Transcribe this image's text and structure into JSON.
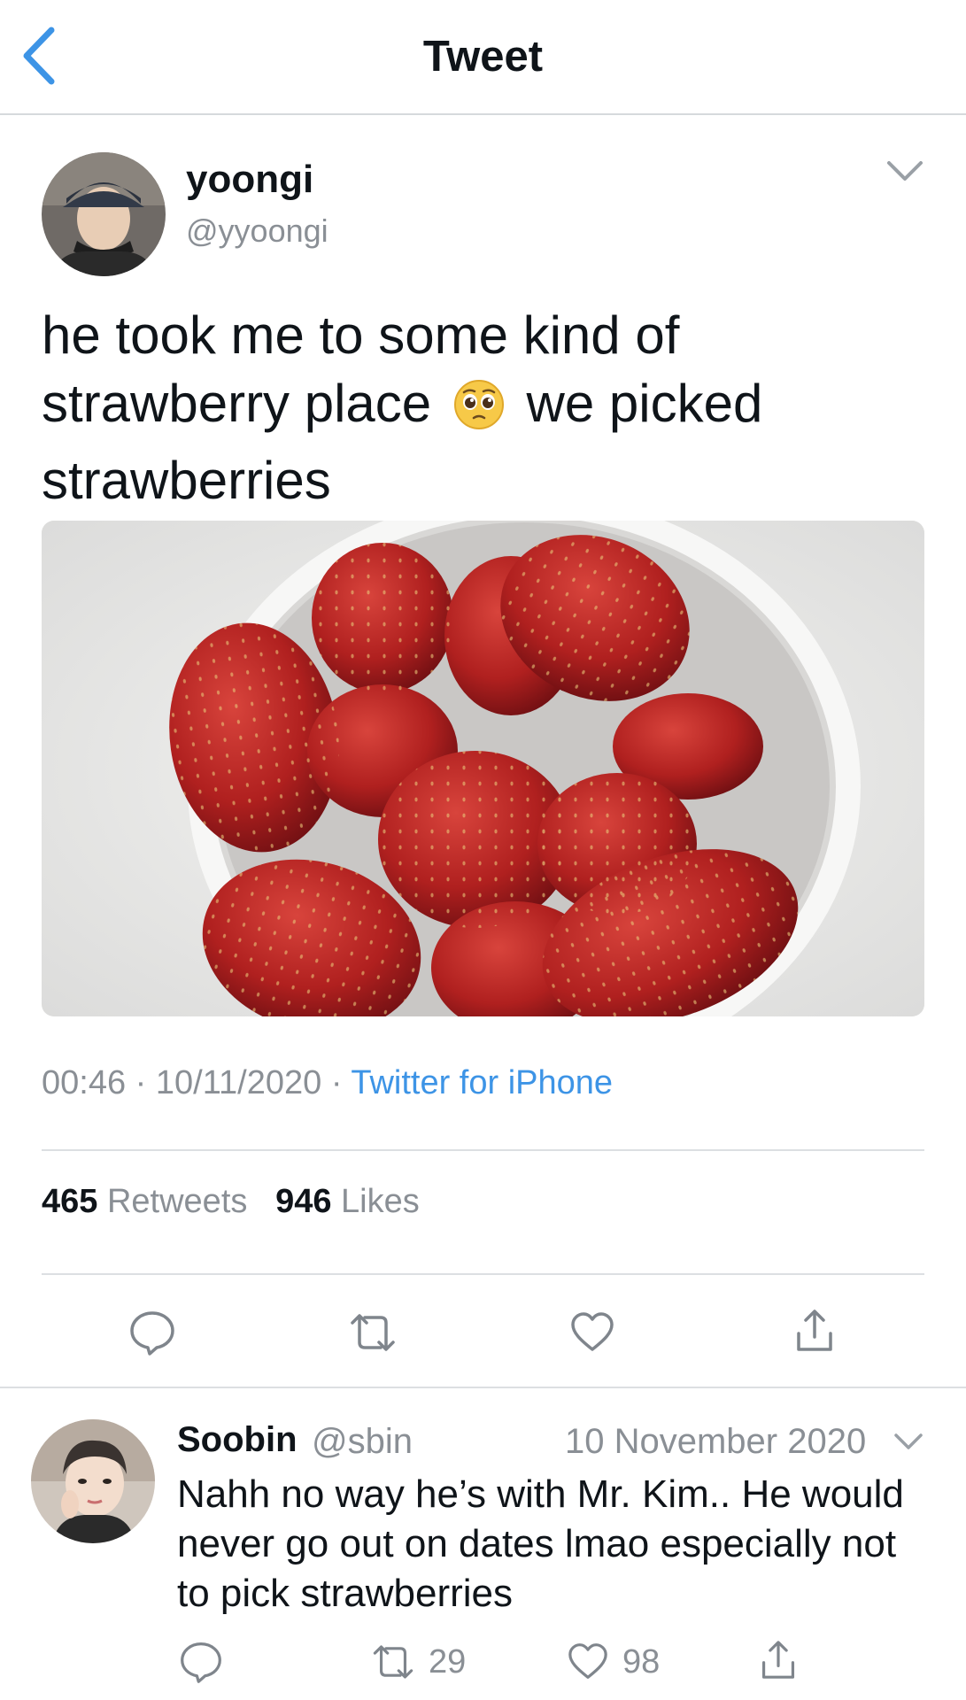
{
  "header": {
    "title": "Tweet",
    "back_icon": "chevron-left-icon"
  },
  "tweet": {
    "author_name": "yoongi",
    "author_handle": "@yyoongi",
    "text_part1": "he took me to some kind of strawberry place",
    "emoji": "pleading-face-emoji",
    "text_part2": "we picked strawberries",
    "time": "00:46",
    "date": "10/11/2020",
    "separator": "·",
    "source": "Twitter for iPhone",
    "retweets_count": "465",
    "retweets_label": "Retweets",
    "likes_count": "946",
    "likes_label": "Likes"
  },
  "reply": {
    "name": "Soobin",
    "handle": "@sbin",
    "date": "10 November 2020",
    "text": "Nahh no way he’s with Mr. Kim.. He would never go out on dates lmao especially not to pick strawberries",
    "retweets": "29",
    "likes": "98"
  },
  "colors": {
    "accent": "#3d94e6",
    "muted": "#8a8f95",
    "text": "#0f1419",
    "divider": "#dcdfe2"
  }
}
